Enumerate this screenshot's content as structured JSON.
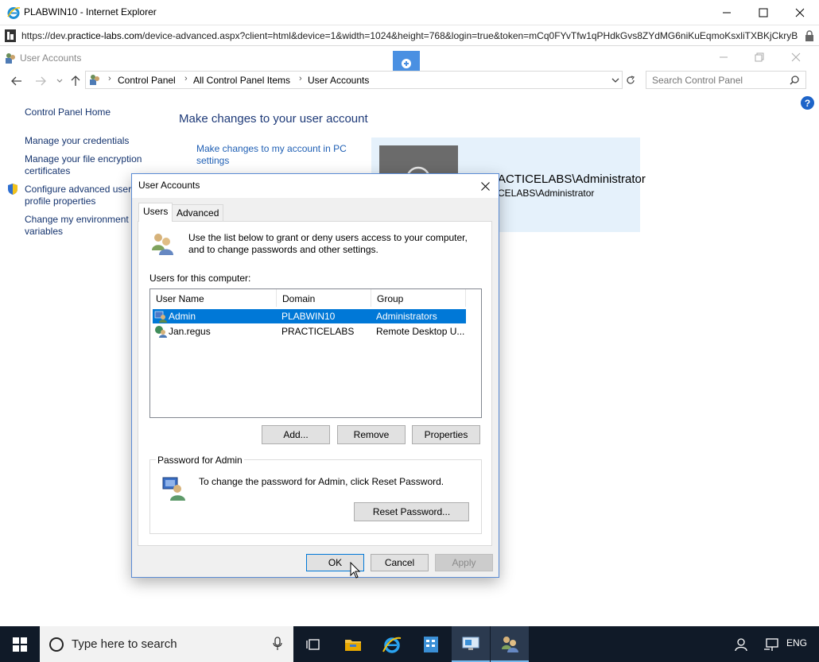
{
  "ie": {
    "title": "PLABWIN10 - Internet Explorer",
    "url_prefix": "https://dev.",
    "url_domain": "practice-labs.com",
    "url_rest": "/device-advanced.aspx?client=html&device=1&width=1024&height=768&login=true&token=mCq0FYvTfw1qPHdkGvs8ZYdMG6niKuEqmoKsxliTXBKjCkryB"
  },
  "cp": {
    "title": "User Accounts",
    "breadcrumb": [
      "Control Panel",
      "All Control Panel Items",
      "User Accounts"
    ],
    "search_placeholder": "Search Control Panel",
    "left_links": {
      "home": "Control Panel Home",
      "credentials": "Manage your credentials",
      "encryption": "Manage your file encryption certificates",
      "advanced_profile": "Configure advanced user profile properties",
      "environment": "Change my environment variables"
    },
    "main_title": "Make changes to your user account",
    "pc_settings_link": "Make changes to my account in PC settings",
    "account_name": "PRACTICELABS\\Administrator",
    "account_sub": "PRACTICELABS\\Administrator",
    "account_name_visible": "ACTICELABS\\Administrator",
    "account_sub_visible": "CELABS\\Administrator"
  },
  "dialog": {
    "title": "User Accounts",
    "tabs": [
      "Users",
      "Advanced"
    ],
    "intro": "Use the list below to grant or deny users access to your computer, and to change passwords and other settings.",
    "users_label": "Users for this computer:",
    "columns": [
      "User Name",
      "Domain",
      "Group"
    ],
    "rows": [
      {
        "name": "Admin",
        "domain": "PLABWIN10",
        "group": "Administrators"
      },
      {
        "name": "Jan.regus",
        "domain": "PRACTICELABS",
        "group": "Remote Desktop U..."
      }
    ],
    "buttons": {
      "add": "Add...",
      "remove": "Remove",
      "properties": "Properties",
      "reset_password": "Reset Password...",
      "ok": "OK",
      "cancel": "Cancel",
      "apply": "Apply"
    },
    "password_legend": "Password for Admin",
    "password_text": "To change the password for Admin, click Reset Password."
  },
  "taskbar": {
    "search_placeholder": "Type here to search",
    "lang": "ENG"
  }
}
